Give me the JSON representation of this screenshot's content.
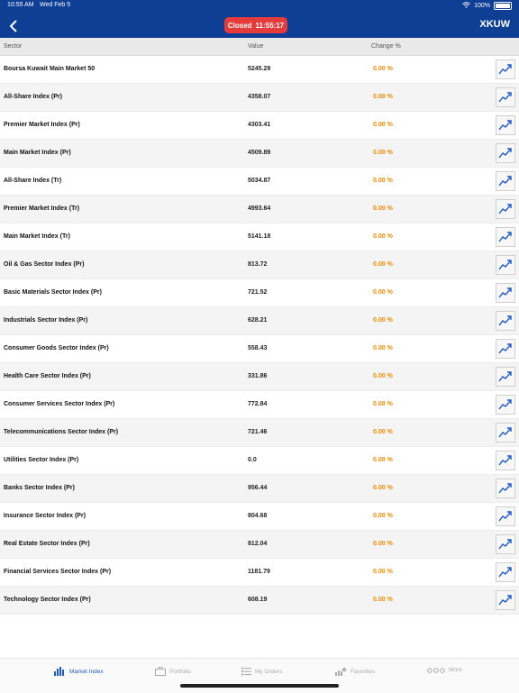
{
  "status_bar": {
    "time": "10:55 AM",
    "date": "Wed Feb 5",
    "battery": "100%"
  },
  "header": {
    "market_status": "Closed",
    "market_time": "11:55:17",
    "market_code": "XKUW"
  },
  "columns": {
    "sector": "Sector",
    "value": "Value",
    "change": "Change %"
  },
  "rows": [
    {
      "name": "Boursa Kuwait Main Market 50",
      "value": "5245.29",
      "change": "0.00 %"
    },
    {
      "name": "All-Share Index (Pr)",
      "value": "4358.07",
      "change": "0.00 %"
    },
    {
      "name": "Premier Market Index  (Pr)",
      "value": "4303.41",
      "change": "0.00 %"
    },
    {
      "name": "Main Market Index (Pr)",
      "value": "4509.89",
      "change": "0.00 %"
    },
    {
      "name": "All-Share Index  (Tr)",
      "value": "5034.87",
      "change": "0.00 %"
    },
    {
      "name": "Premier Market Index (Tr)",
      "value": "4993.64",
      "change": "0.00 %"
    },
    {
      "name": "Main Market Index (Tr)",
      "value": "5141.18",
      "change": "0.00 %"
    },
    {
      "name": "Oil & Gas Sector Index (Pr)",
      "value": "813.72",
      "change": "0.00 %"
    },
    {
      "name": "Basic Materials Sector Index (Pr)",
      "value": "721.52",
      "change": "0.00 %"
    },
    {
      "name": "Industrials Sector Index (Pr)",
      "value": "628.21",
      "change": "0.00 %"
    },
    {
      "name": "Consumer Goods Sector Index (Pr)",
      "value": "558.43",
      "change": "0.00 %"
    },
    {
      "name": "Health Care Sector Index (Pr)",
      "value": "331.86",
      "change": "0.00 %"
    },
    {
      "name": "Consumer Services Sector Index (Pr)",
      "value": "772.84",
      "change": "0.00 %"
    },
    {
      "name": "Telecommunications Sector Index (Pr)",
      "value": "721.46",
      "change": "0.00 %"
    },
    {
      "name": "Utilities Sector Index (Pr)",
      "value": "0.0",
      "change": "0.00 %"
    },
    {
      "name": "Banks Sector Index (Pr)",
      "value": "956.44",
      "change": "0.00 %"
    },
    {
      "name": "Insurance Sector Index (Pr)",
      "value": "804.68",
      "change": "0.00 %"
    },
    {
      "name": "Real Estate Sector Index (Pr)",
      "value": "812.04",
      "change": "0.00 %"
    },
    {
      "name": "Financial Services Sector Index (Pr)",
      "value": "1181.79",
      "change": "0.00 %"
    },
    {
      "name": "Technology Sector Index (Pr)",
      "value": "608.19",
      "change": "0.00 %"
    }
  ],
  "tabs": [
    {
      "label": "Market Index",
      "icon": "bar-chart-icon",
      "active": true
    },
    {
      "label": "Portfolio",
      "icon": "briefcase-icon",
      "active": false
    },
    {
      "label": "My Orders",
      "icon": "list-icon",
      "active": false
    },
    {
      "label": "Favorites",
      "icon": "chart-star-icon",
      "active": false
    },
    {
      "label": "More",
      "icon": "more-dots-icon",
      "active": false
    }
  ],
  "colors": {
    "header_bg": "#0f3f94",
    "closed_pill": "#e53b3b",
    "change_text": "#f08b00",
    "active_tab": "#1f5ac7",
    "trend_line": "#1f5ac7"
  }
}
